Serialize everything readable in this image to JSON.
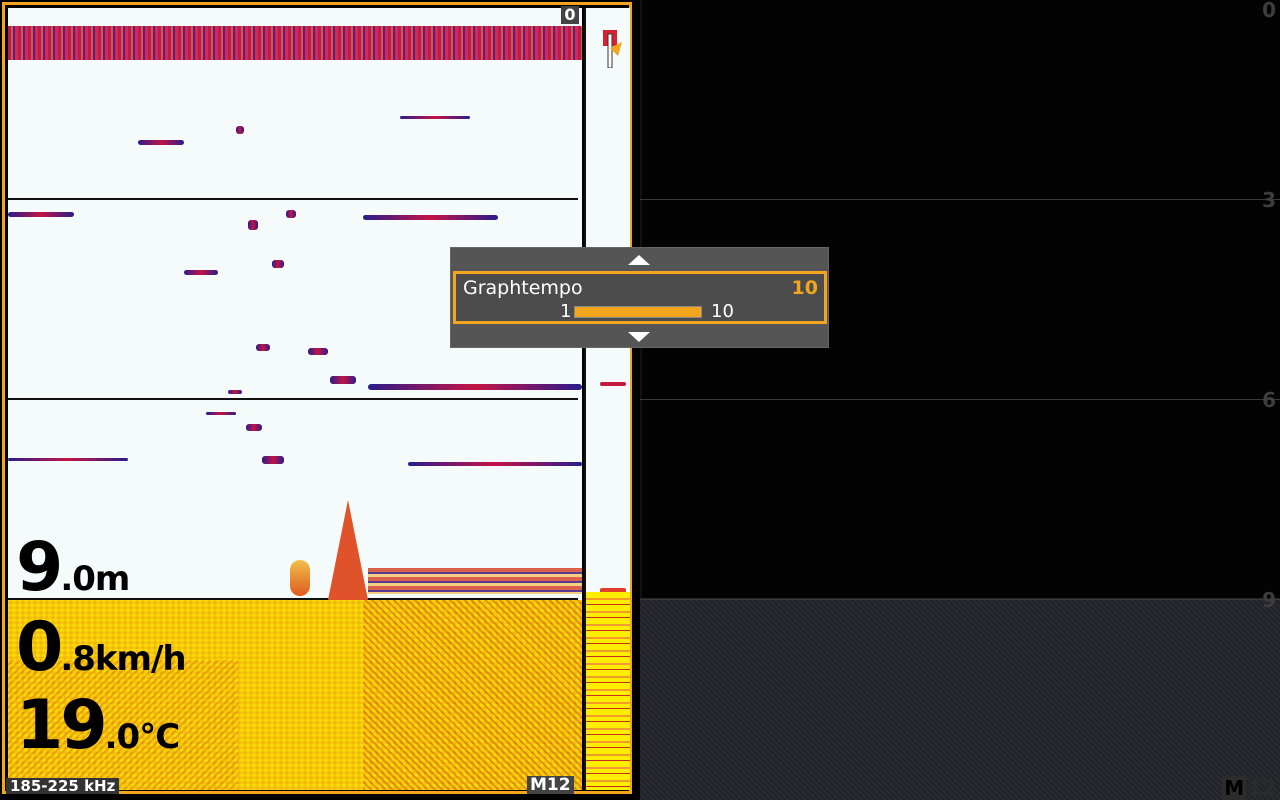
{
  "left_pane": {
    "readouts": {
      "depth": {
        "int": "9",
        "dec": ".0m"
      },
      "speed": {
        "int": "0",
        "dec": ".8km/h"
      },
      "temp": {
        "int": "19",
        "dec": ".0°C"
      }
    },
    "frequency_label": "185-225 kHz",
    "top_depth_label": "0",
    "mode_label": "M12"
  },
  "right_pane": {
    "depth_scale": [
      "0",
      "3",
      "6",
      "9"
    ],
    "mode_label": {
      "m": "M",
      "n": "12"
    }
  },
  "popup": {
    "title": "Graphtempo",
    "value": "10",
    "min": "1",
    "max": "10",
    "level_fraction": 1.0
  },
  "colors": {
    "accent": "#f2a51d",
    "popup_bg": "#555555",
    "bottom": "#ffee00"
  }
}
